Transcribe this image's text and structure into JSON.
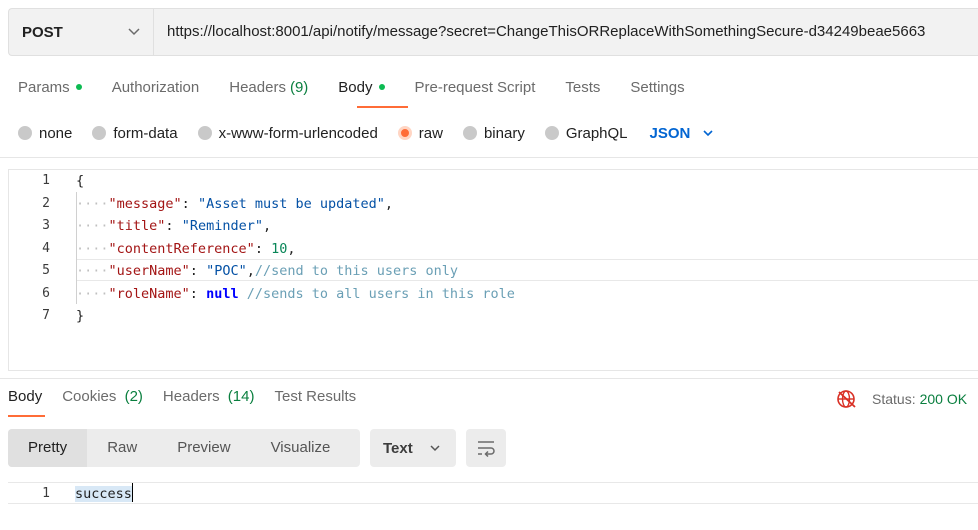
{
  "request": {
    "method": "POST",
    "url": "https://localhost:8001/api/notify/message?secret=ChangeThisORReplaceWithSomethingSecure-d34249beae5663"
  },
  "request_tabs": [
    {
      "label": "Params",
      "dot": true,
      "count": ""
    },
    {
      "label": "Authorization",
      "dot": false,
      "count": ""
    },
    {
      "label": "Headers",
      "dot": false,
      "count": "(9)"
    },
    {
      "label": "Body",
      "dot": true,
      "count": "",
      "active": true
    },
    {
      "label": "Pre-request Script",
      "dot": false,
      "count": ""
    },
    {
      "label": "Tests",
      "dot": false,
      "count": ""
    },
    {
      "label": "Settings",
      "dot": false,
      "count": ""
    }
  ],
  "body_types": {
    "none": "none",
    "form_data": "form-data",
    "urlencoded": "x-www-form-urlencoded",
    "raw": "raw",
    "binary": "binary",
    "graphql": "GraphQL",
    "format": "JSON",
    "selected": "raw"
  },
  "editor": {
    "line_numbers": [
      "1",
      "2",
      "3",
      "4",
      "5",
      "6",
      "7"
    ],
    "open_brace": "{",
    "close_brace": "}",
    "l2": {
      "key": "\"message\"",
      "value": "\"Asset must be updated\""
    },
    "l3": {
      "key": "\"title\"",
      "value": "\"Reminder\""
    },
    "l4": {
      "key": "\"contentReference\"",
      "value": "10"
    },
    "l5": {
      "key": "\"userName\"",
      "value": "\"POC\"",
      "comment": "//send to this users only"
    },
    "l6": {
      "key": "\"roleName\"",
      "value": "null",
      "comment": "//sends to all users in this role"
    }
  },
  "response_tabs": {
    "body": "Body",
    "cookies": "Cookies",
    "cookies_count": "(2)",
    "headers": "Headers",
    "headers_count": "(14)",
    "test_results": "Test Results"
  },
  "status": {
    "label": "Status:",
    "value": "200 OK"
  },
  "views": [
    "Pretty",
    "Raw",
    "Preview",
    "Visualize"
  ],
  "response_format": "Text",
  "response": {
    "line_number": "1",
    "text": "success"
  },
  "colors": {
    "accent": "#ff6c37",
    "success": "#0cbb52",
    "link": "#0265d2"
  }
}
